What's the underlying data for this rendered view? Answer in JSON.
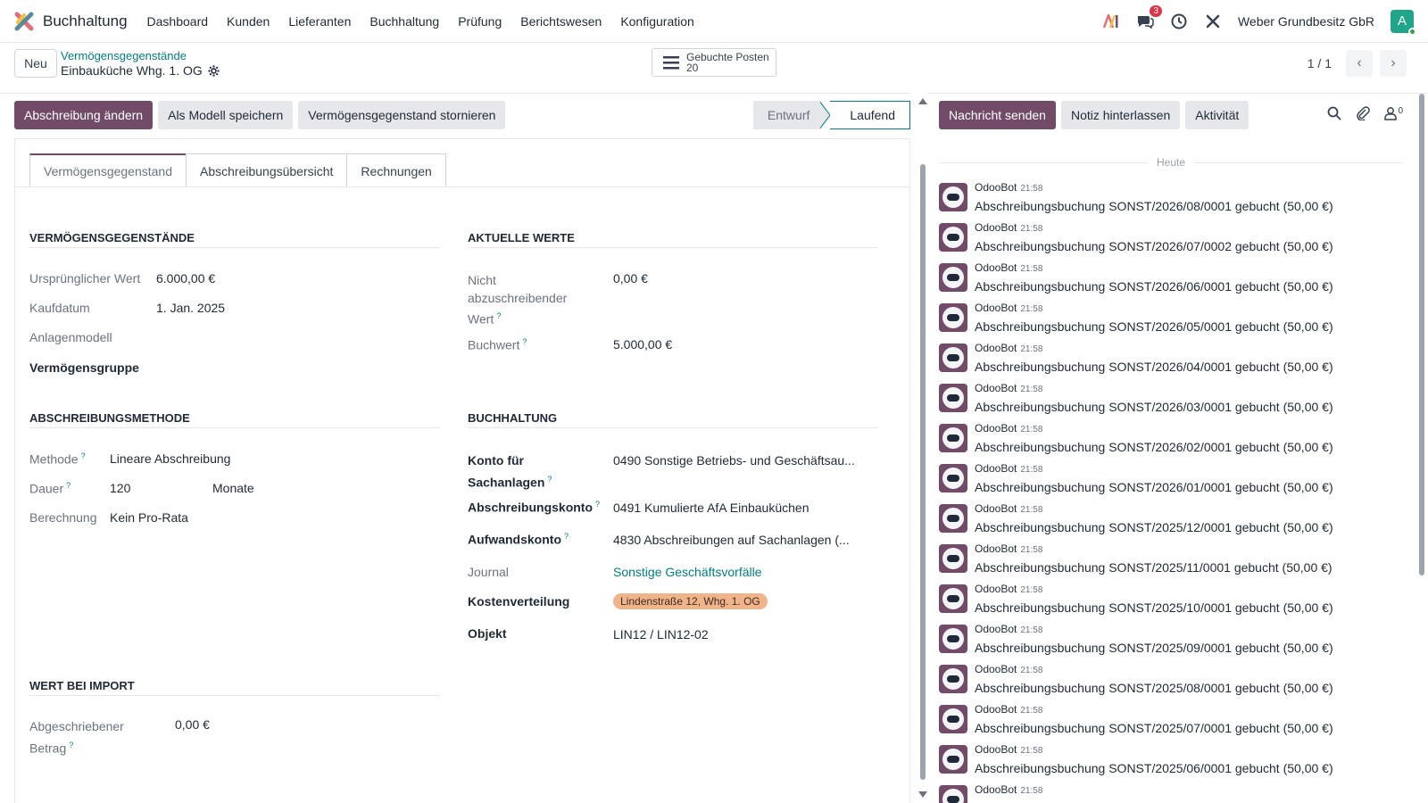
{
  "navbar": {
    "app_name": "Buchhaltung",
    "menu": [
      "Dashboard",
      "Kunden",
      "Lieferanten",
      "Buchhaltung",
      "Prüfung",
      "Berichtswesen",
      "Konfiguration"
    ],
    "chat_badge": "3",
    "company": "Weber Grundbesitz GbR",
    "avatar_letter": "A"
  },
  "control": {
    "new_label": "Neu",
    "breadcrumb_parent": "Vermögensgegenstände",
    "record_name": "Einbauküche Whg. 1. OG",
    "smart_button_label": "Gebuchte Posten",
    "smart_button_count": "20",
    "pager": "1 / 1"
  },
  "actions": {
    "modify": "Abschreibung ändern",
    "save_model": "Als Modell speichern",
    "cancel_asset": "Vermögensgegenstand stornieren"
  },
  "stages": {
    "draft": "Entwurf",
    "running": "Laufend"
  },
  "tabs": [
    "Vermögensgegenstand",
    "Abschreibungsübersicht",
    "Rechnungen"
  ],
  "groups": {
    "assets": {
      "title": "VERMÖGENSGEGENSTÄNDE",
      "original_value_label": "Ursprünglicher Wert",
      "original_value": "6.000,00 €",
      "purchase_date_label": "Kaufdatum",
      "purchase_date": "1. Jan. 2025",
      "model_label": "Anlagenmodell",
      "group_label": "Vermögensgruppe"
    },
    "current": {
      "title": "AKTUELLE WERTE",
      "non_depr_label_1": "Nicht",
      "non_depr_label_2": "abzuschreibender",
      "non_depr_label_3": "Wert",
      "non_depr_value": "0,00 €",
      "book_value_label": "Buchwert",
      "book_value": "5.000,00 €"
    },
    "method": {
      "title": "ABSCHREIBUNGSMETHODE",
      "method_label": "Methode",
      "method_value": "Lineare Abschreibung",
      "duration_label": "Dauer",
      "duration_value": "120",
      "duration_unit": "Monate",
      "computation_label": "Berechnung",
      "computation_value": "Kein Pro-Rata"
    },
    "accounting": {
      "title": "BUCHHALTUNG",
      "fixed_account_label_1": "Konto für",
      "fixed_account_label_2": "Sachanlagen",
      "fixed_account_value": "0490 Sonstige Betriebs- und Geschäftsau...",
      "depr_account_label": "Abschreibungskonto",
      "depr_account_value": "0491 Kumulierte AfA Einbauküchen",
      "expense_account_label": "Aufwandskonto",
      "expense_account_value": "4830 Abschreibungen auf Sachanlagen (...",
      "journal_label": "Journal",
      "journal_value": "Sonstige Geschäftsvorfälle",
      "analytic_label": "Kostenverteilung",
      "analytic_tag": "Lindenstraße 12, Whg. 1. OG",
      "object_label": "Objekt",
      "object_value": "LIN12 / LIN12-02"
    },
    "import": {
      "title": "WERT BEI IMPORT",
      "depreciated_label_1": "Abgeschriebener",
      "depreciated_label_2": "Betrag",
      "depreciated_value": "0,00 €"
    }
  },
  "chatter": {
    "send_message": "Nachricht senden",
    "log_note": "Notiz hinterlassen",
    "activity": "Aktivität",
    "followers_count": "0",
    "today": "Heute",
    "messages": [
      {
        "author": "OdooBot",
        "time": "21:58",
        "body": "Abschreibungsbuchung SONST/2026/08/0001 gebucht (50,00 €)"
      },
      {
        "author": "OdooBot",
        "time": "21:58",
        "body": "Abschreibungsbuchung SONST/2026/07/0002 gebucht (50,00 €)"
      },
      {
        "author": "OdooBot",
        "time": "21:58",
        "body": "Abschreibungsbuchung SONST/2026/06/0001 gebucht (50,00 €)"
      },
      {
        "author": "OdooBot",
        "time": "21:58",
        "body": "Abschreibungsbuchung SONST/2026/05/0001 gebucht (50,00 €)"
      },
      {
        "author": "OdooBot",
        "time": "21:58",
        "body": "Abschreibungsbuchung SONST/2026/04/0001 gebucht (50,00 €)"
      },
      {
        "author": "OdooBot",
        "time": "21:58",
        "body": "Abschreibungsbuchung SONST/2026/03/0001 gebucht (50,00 €)"
      },
      {
        "author": "OdooBot",
        "time": "21:58",
        "body": "Abschreibungsbuchung SONST/2026/02/0001 gebucht (50,00 €)"
      },
      {
        "author": "OdooBot",
        "time": "21:58",
        "body": "Abschreibungsbuchung SONST/2026/01/0001 gebucht (50,00 €)"
      },
      {
        "author": "OdooBot",
        "time": "21:58",
        "body": "Abschreibungsbuchung SONST/2025/12/0001 gebucht (50,00 €)"
      },
      {
        "author": "OdooBot",
        "time": "21:58",
        "body": "Abschreibungsbuchung SONST/2025/11/0001 gebucht (50,00 €)"
      },
      {
        "author": "OdooBot",
        "time": "21:58",
        "body": "Abschreibungsbuchung SONST/2025/10/0001 gebucht (50,00 €)"
      },
      {
        "author": "OdooBot",
        "time": "21:58",
        "body": "Abschreibungsbuchung SONST/2025/09/0001 gebucht (50,00 €)"
      },
      {
        "author": "OdooBot",
        "time": "21:58",
        "body": "Abschreibungsbuchung SONST/2025/08/0001 gebucht (50,00 €)"
      },
      {
        "author": "OdooBot",
        "time": "21:58",
        "body": "Abschreibungsbuchung SONST/2025/07/0001 gebucht (50,00 €)"
      },
      {
        "author": "OdooBot",
        "time": "21:58",
        "body": "Abschreibungsbuchung SONST/2025/06/0001 gebucht (50,00 €)"
      },
      {
        "author": "OdooBot",
        "time": "21:58",
        "body": ""
      }
    ]
  },
  "colors": {
    "primary": "#714b67",
    "link": "#017e84",
    "tag": "#f0b48a"
  }
}
